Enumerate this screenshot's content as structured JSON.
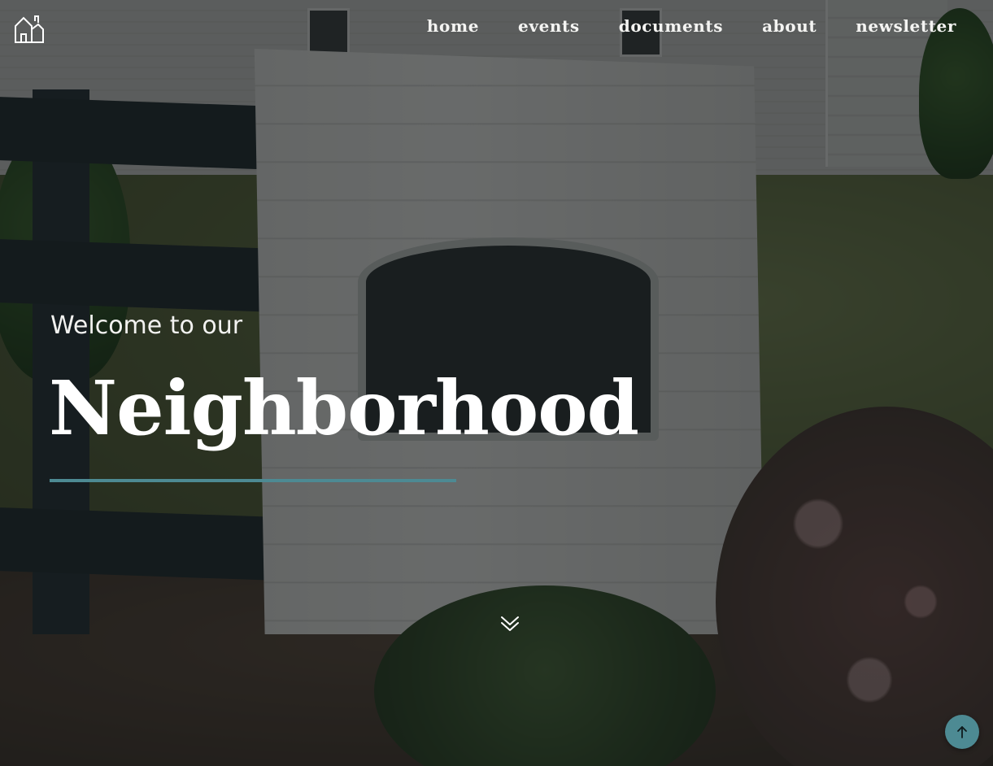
{
  "header": {
    "logo_icon": "house-icon",
    "nav": [
      {
        "id": "home",
        "label": "home"
      },
      {
        "id": "events",
        "label": "events"
      },
      {
        "id": "documents",
        "label": "documents"
      },
      {
        "id": "about",
        "label": "about"
      },
      {
        "id": "newsletter",
        "label": "newsletter"
      }
    ]
  },
  "hero": {
    "eyebrow": "Welcome to our",
    "title": "Neighborhood",
    "scroll_icon": "double-chevron-down-icon"
  },
  "back_to_top": {
    "icon": "arrow-up-icon"
  },
  "colors": {
    "accent": "#4d8a93",
    "overlay": "#0e1012",
    "text": "#ffffff"
  }
}
